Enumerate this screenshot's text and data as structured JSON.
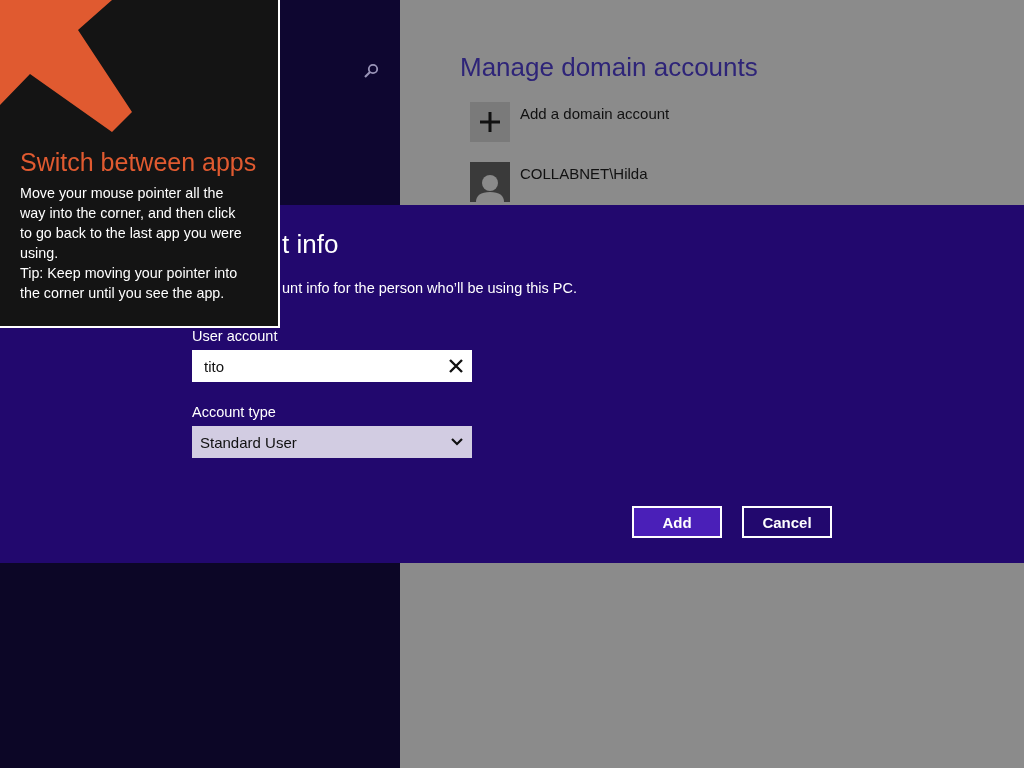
{
  "tooltip": {
    "title": "Switch between apps",
    "body": "Move your mouse pointer all the way into the corner, and then click to go back to the last app you were using.",
    "tip": "Tip: Keep moving your pointer into the corner until you see the app."
  },
  "background": {
    "heading": "Manage domain accounts",
    "items": [
      {
        "kind": "add",
        "label": "Add a domain account"
      },
      {
        "kind": "user",
        "label": "COLLABNET\\Hilda"
      }
    ]
  },
  "dialog": {
    "title": "t info",
    "description": "unt info for the person who’ll be using this PC.",
    "fields": [
      {
        "kind": "text",
        "label": "User account",
        "value": "tito"
      },
      {
        "kind": "select",
        "label": "Account type",
        "value": "Standard User"
      }
    ],
    "buttons": [
      {
        "label": "Add",
        "primary": true
      },
      {
        "label": "Cancel",
        "primary": false
      }
    ]
  }
}
